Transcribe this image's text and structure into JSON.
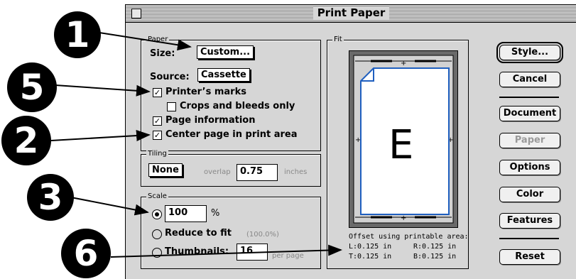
{
  "dialog": {
    "title": "Print Paper",
    "paper_group": {
      "label": "Paper",
      "size_label": "Size:",
      "size_value": "Custom...",
      "source_label": "Source:",
      "source_value": "Cassette",
      "printers_marks": {
        "label": "Printer’s marks",
        "checked": true
      },
      "crops_bleeds": {
        "label": "Crops and bleeds only",
        "checked": false
      },
      "page_info": {
        "label": "Page information",
        "checked": true
      },
      "center_page": {
        "label": "Center page in print area",
        "checked": true
      }
    },
    "tiling_group": {
      "label": "Tiling",
      "mode_value": "None",
      "overlap_label": "overlap",
      "overlap_value": "0.75",
      "units_label": "inches"
    },
    "scale_group": {
      "label": "Scale",
      "percent_value": "100",
      "percent_sign": "%",
      "reduce_label": "Reduce to fit",
      "reduce_value": "(100.0%)",
      "thumbnails_label": "Thumbnails:",
      "thumbnails_value": "16",
      "per_page_label": "per page",
      "selected": "percent"
    },
    "fit_group": {
      "label": "Fit",
      "page_letter": "E",
      "offset_title": "Offset using printable area:",
      "offsets": {
        "L": "L:0.125 in",
        "R": "R:0.125 in",
        "T": "T:0.125 in",
        "B": "B:0.125 in"
      }
    },
    "buttons": {
      "style": "Style...",
      "cancel": "Cancel",
      "document": "Document",
      "paper": "Paper",
      "options": "Options",
      "color": "Color",
      "features": "Features",
      "reset": "Reset"
    }
  },
  "callouts": [
    "1",
    "5",
    "2",
    "3",
    "6"
  ],
  "colors": {
    "page_outline": "#1f5fbf",
    "background": "#d6d6d6"
  }
}
